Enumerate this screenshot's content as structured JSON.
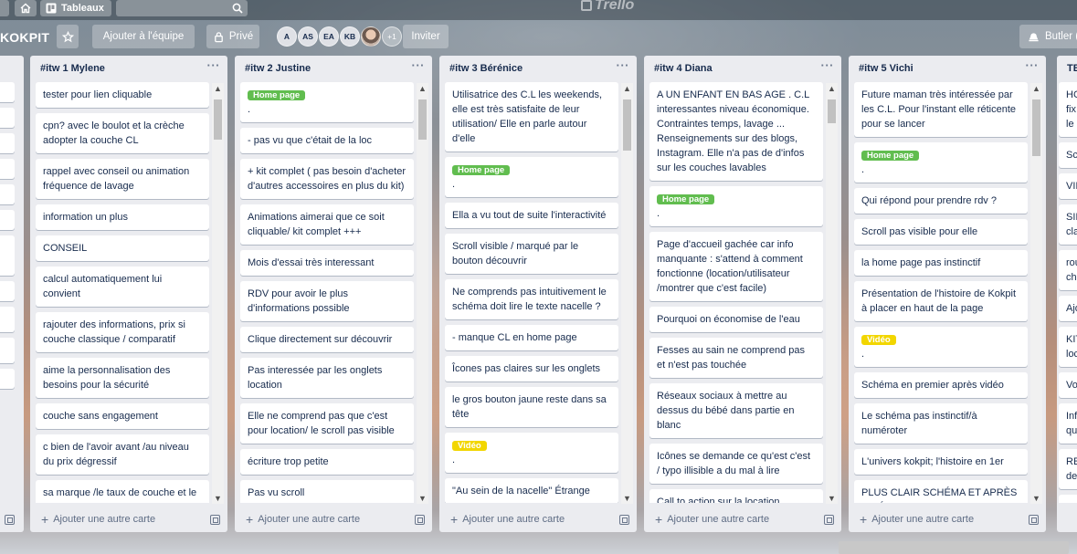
{
  "topbar": {
    "boards_label": "Tableaux",
    "logo_text": "Trello",
    "icons": [
      "grid-icon",
      "home-icon",
      "boards-icon",
      "search-icon"
    ]
  },
  "board": {
    "title": "KOKPIT",
    "add_team_label": "Ajouter à l'équipe",
    "visibility_label": "Privé",
    "invite_label": "Inviter",
    "butler_label": "Butler (",
    "members": [
      "A",
      "AS",
      "EA",
      "KB"
    ],
    "more_members": "+1"
  },
  "left_partial": {
    "cards": [
      "",
      "",
      "",
      "",
      "",
      "",
      "en\ntre",
      "",
      "ils",
      "es",
      ""
    ]
  },
  "lists": [
    {
      "title": "#itw 1 Mylene",
      "add_label": "Ajouter une autre carte",
      "cards": [
        {
          "text": "tester pour lien cliquable"
        },
        {
          "text": "cpn? avec le boulot et la crèche adopter la couche CL"
        },
        {
          "text": "rappel avec conseil ou animation fréquence de lavage"
        },
        {
          "text": "information un plus"
        },
        {
          "text": "CONSEIL"
        },
        {
          "text": "calcul automatiquement lui convient"
        },
        {
          "text": "rajouter des informations, prix si couche classique / comparatif"
        },
        {
          "text": "aime la personnalisation des besoins pour la sécurité"
        },
        {
          "text": "couche sans engagement"
        },
        {
          "text": "c bien de l'avoir avant /au niveau du prix dégressif"
        },
        {
          "text": "sa marque /le taux de couche et le litre d'eaux"
        }
      ]
    },
    {
      "title": "#itw 2 Justine",
      "add_label": "Ajouter une autre carte",
      "cards": [
        {
          "label": "Home page",
          "label_color": "#61bd4f",
          "text": "."
        },
        {
          "text": "- pas vu que c'était de la loc"
        },
        {
          "text": "+ kit complet ( pas besoin d'acheter d'autres accessoires en plus du kit)"
        },
        {
          "text": "Animations aimerai que ce soit cliquable/ kit complet +++"
        },
        {
          "text": "Mois d'essai très interessant"
        },
        {
          "text": "RDV pour avoir le plus d'informations possible"
        },
        {
          "text": "Clique directement sur découvrir"
        },
        {
          "text": "Pas interessée par les onglets location"
        },
        {
          "text": "Elle ne comprend pas que c'est pour location/ le scroll pas visible"
        },
        {
          "text": "écriture trop petite"
        },
        {
          "text": "Pas vu scroll"
        }
      ]
    },
    {
      "title": "#itw 3 Bérénice",
      "add_label": "Ajouter une autre carte",
      "cards": [
        {
          "text": "Utilisatrice des C.L les weekends, elle est très satisfaite de leur utilisation/ Elle en parle autour d'elle"
        },
        {
          "label": "Home page",
          "label_color": "#61bd4f",
          "text": "."
        },
        {
          "text": "Ella a vu tout de suite l'interactivité"
        },
        {
          "text": "Scroll visible / marqué par le bouton découvrir"
        },
        {
          "text": "Ne comprends pas intuitivement le schéma doit lire le texte nacelle ?"
        },
        {
          "text": "- manque CL en home page"
        },
        {
          "text": "Îcones pas claires sur les onglets"
        },
        {
          "text": "le gros bouton jaune reste dans sa tête"
        },
        {
          "label": "Vidéo",
          "label_color": "#f2d600",
          "text": "."
        },
        {
          "text": "\"Au sein de la nacelle\" Étrange"
        }
      ]
    },
    {
      "title": "#itw 4 Diana",
      "add_label": "Ajouter une autre carte",
      "cards": [
        {
          "text": "A UN ENFANT EN BAS AGE . C.L interessantes niveau économique. Contraintes temps, lavage ... Renseignements sur des blogs, Instagram. Elle n'a pas de d'infos sur les couches lavables"
        },
        {
          "label": "Home page",
          "label_color": "#61bd4f",
          "text": "."
        },
        {
          "text": "Page d'accueil gachée car info manquante : s'attend à comment fonctionne (location/utilisateur /montrer que c'est facile)"
        },
        {
          "text": "Pourquoi on économise de l'eau"
        },
        {
          "text": "Fesses au sain ne comprend pas et n'est pas touchée"
        },
        {
          "text": "Réseaux sociaux à mettre au dessus du bébé dans partie en blanc"
        },
        {
          "text": "Icônes se demande ce qu'est c'est / typo illisible a du mal à lire"
        },
        {
          "text": "Call to action sur la location souhaité en bas après toutes les"
        }
      ]
    },
    {
      "title": "#itw 5 Vichi",
      "add_label": "Ajouter une autre carte",
      "cards": [
        {
          "text": "Future maman très intéressée par les C.L. Pour l'instant elle réticente pour se lancer"
        },
        {
          "label": "Home page",
          "label_color": "#61bd4f",
          "text": "."
        },
        {
          "text": "Qui répond pour prendre rdv ?"
        },
        {
          "text": "Scroll pas visible pour elle"
        },
        {
          "text": "la home page pas instinctif"
        },
        {
          "text": "Présentation de l'histoire de Kokpit à placer en haut de la page"
        },
        {
          "label": "Vidéo",
          "label_color": "#f2d600",
          "text": "."
        },
        {
          "text": "Schéma en premier après vidéo"
        },
        {
          "text": "Le schéma pas instinctif/à numéroter"
        },
        {
          "text": "L'univers kokpit; l'histoire en 1er"
        },
        {
          "text": "PLUS CLAIR SCHÉMA ET APRÈS VIDÉO"
        }
      ]
    }
  ],
  "right_partial": {
    "title": "TE",
    "cards": [
      "HC\nfix\nle",
      "Sc",
      "VII",
      "SII\ncla",
      "rou\nch",
      "Ajo",
      "KIT\nloc",
      "Vo",
      "Inf\nqu",
      "RE\nde",
      "cro"
    ]
  }
}
